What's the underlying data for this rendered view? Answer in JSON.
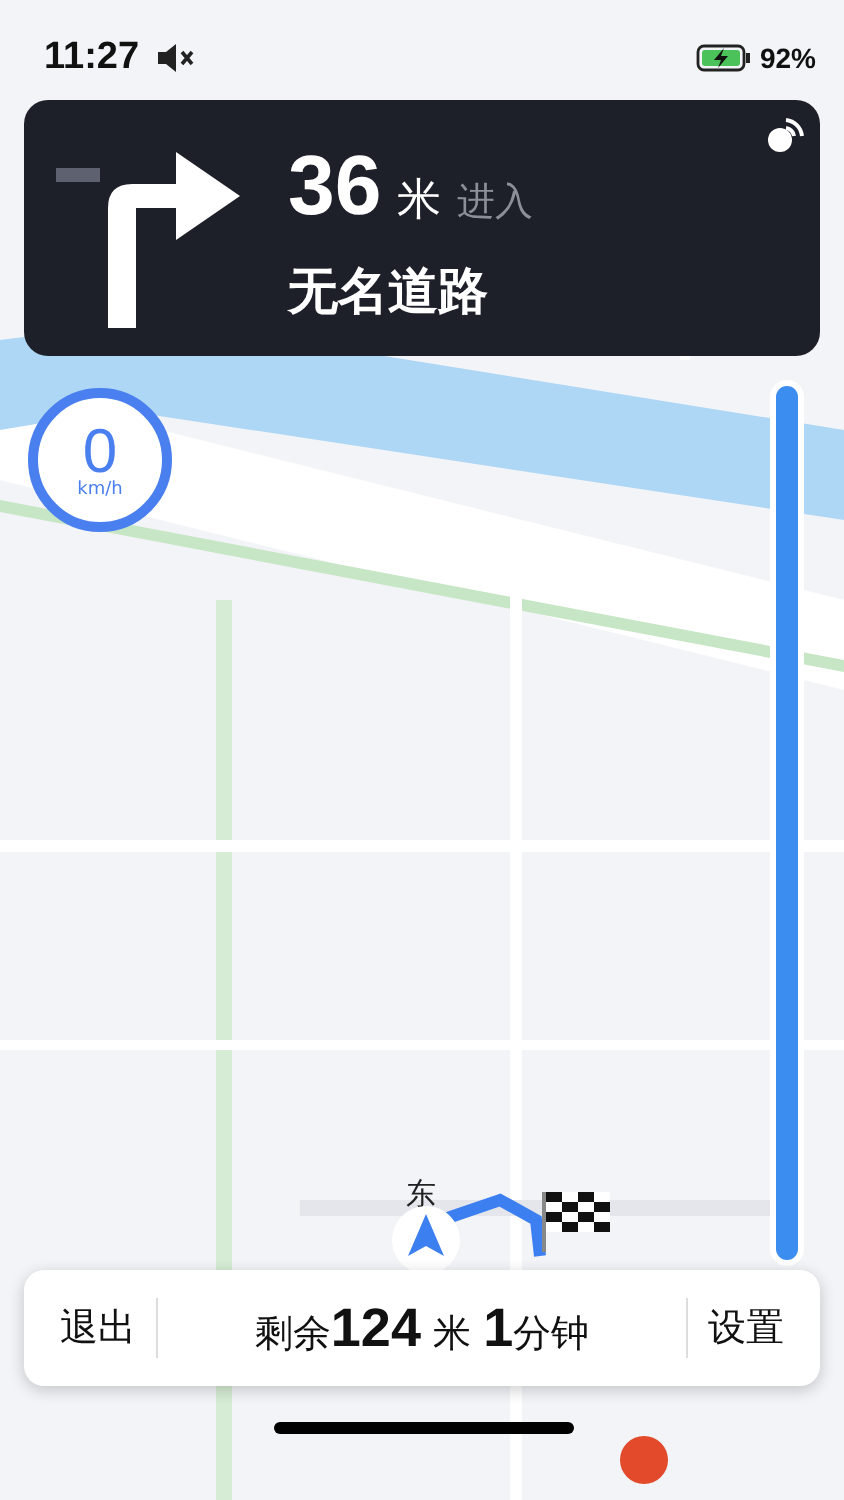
{
  "status_bar": {
    "time": "11:27",
    "muted": true,
    "charging": true,
    "battery_percent": "92%"
  },
  "guidance": {
    "kind": "right_turn",
    "distance": "36",
    "unit": "米",
    "action": "进入",
    "road": "无名道路"
  },
  "speed": {
    "value": "0",
    "unit": "km/h"
  },
  "route_progress": {
    "level": 1
  },
  "vehicle": {
    "heading_label": "东"
  },
  "bottom_bar": {
    "exit": "退出",
    "summary": "剩余**124** 米 **1**分钟",
    "settings": "设置"
  }
}
